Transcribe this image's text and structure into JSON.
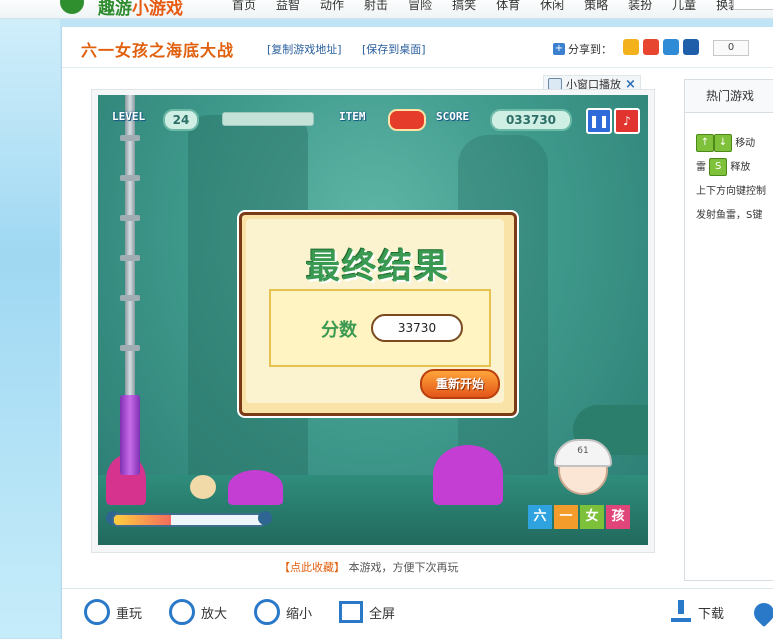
{
  "nav": {
    "logo_main": "趣游",
    "logo_accent": "小游戏",
    "items": [
      "首页",
      "益智",
      "动作",
      "射击",
      "冒险",
      "搞笑",
      "体育",
      "休闲",
      "策略",
      "装扮",
      "儿童",
      "换装"
    ]
  },
  "header": {
    "title": "六一女孩之海底大战",
    "copy_link": "[复制游戏地址]",
    "save_desktop": "[保存到桌面]",
    "share_label": "分享到：",
    "share_count": "0"
  },
  "mini_window": {
    "label": "小窗口播放",
    "close": "×"
  },
  "game": {
    "level_label": "LEVEL",
    "level_value": "24",
    "item_label": "ITEM",
    "score_label": "SCORE",
    "score_value": "033730",
    "result_title": "最终结果",
    "result_score_label": "分数",
    "result_score_value": "33730",
    "restart_label": "重新开始",
    "badge_tiles": [
      "六",
      "一",
      "女",
      "孩"
    ],
    "girl_number": "61",
    "progress_fraction": 0.38
  },
  "caption": {
    "highlight": "【点此收藏】",
    "text": "本游戏，方便下次再玩"
  },
  "sidebar": {
    "tab": "热门游戏",
    "line1_suffix": "移动",
    "line2_prefix": "雷",
    "line2_key": "S",
    "line2_suffix": "释放",
    "line3": "上下方向键控制",
    "line4": "发射鱼雷，S键"
  },
  "bottombar": {
    "replay": "重玩",
    "zoom_in": "放大",
    "zoom_out": "缩小",
    "fullscreen": "全屏",
    "download": "下载"
  }
}
